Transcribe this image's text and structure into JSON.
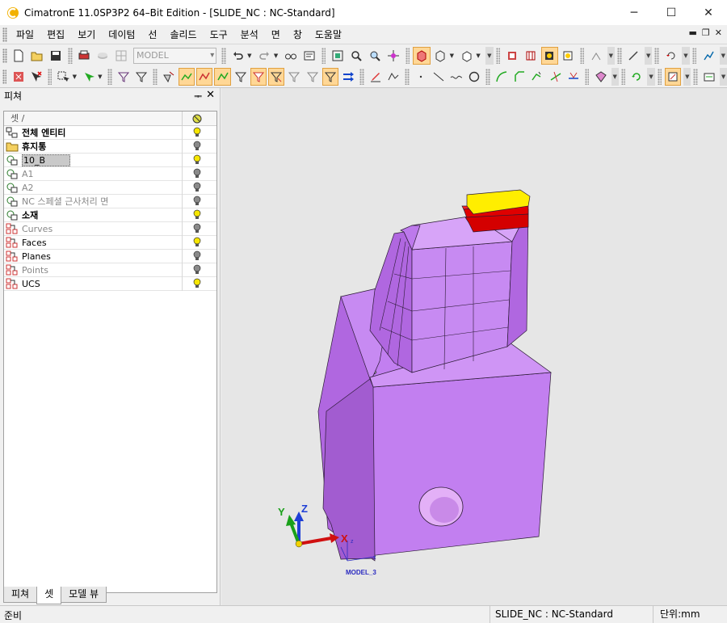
{
  "window": {
    "title": "CimatronE 11.0SP3P2 64–Bit Edition - [SLIDE_NC : NC-Standard]",
    "minimize": "─",
    "maximize": "☐",
    "close": "✕"
  },
  "menu": {
    "items": [
      "파일",
      "편집",
      "보기",
      "데이텀",
      "선",
      "솔리드",
      "도구",
      "분석",
      "면",
      "창",
      "도움말"
    ],
    "mdi": {
      "minimize": "▬",
      "restore": "❐",
      "close": "✕"
    }
  },
  "toolbar": {
    "model_combo": "MODEL"
  },
  "panel": {
    "title": "피쳐",
    "pin": "ᅟ꾸",
    "close": "✕",
    "column_header": "셋 /",
    "rows": [
      {
        "label": "전체 엔티티",
        "state": "bold",
        "bulb": "on"
      },
      {
        "label": "휴지통",
        "state": "bold",
        "bulb": "off"
      },
      {
        "label": "10_B",
        "state": "normal",
        "bulb": "on",
        "selected": true
      },
      {
        "label": "A1",
        "state": "dim",
        "bulb": "off"
      },
      {
        "label": "A2",
        "state": "dim",
        "bulb": "off"
      },
      {
        "label": "NC 스페셜 근사처리 면",
        "state": "dim",
        "bulb": "off"
      },
      {
        "label": "소재",
        "state": "bold",
        "bulb": "on"
      },
      {
        "label": "Curves",
        "state": "dim",
        "bulb": "off"
      },
      {
        "label": "Faces",
        "state": "normal",
        "bulb": "on"
      },
      {
        "label": "Planes",
        "state": "normal",
        "bulb": "off"
      },
      {
        "label": "Points",
        "state": "dim",
        "bulb": "off"
      },
      {
        "label": "UCS",
        "state": "normal",
        "bulb": "on"
      }
    ],
    "tabs": [
      "피쳐",
      "셋",
      "모델 뷰"
    ],
    "active_tab": "셋"
  },
  "viewport": {
    "axis_labels": {
      "y": "Y",
      "z": "Z",
      "x": "X"
    },
    "ucs_name": "MODEL_3",
    "colors": {
      "part": "#c07ae8",
      "part_dark": "#a25cd0",
      "top_face": "#ffee00",
      "red_face": "#e00000"
    }
  },
  "status": {
    "left": "준비",
    "document": "SLIDE_NC : NC-Standard",
    "units": "단위:mm"
  }
}
